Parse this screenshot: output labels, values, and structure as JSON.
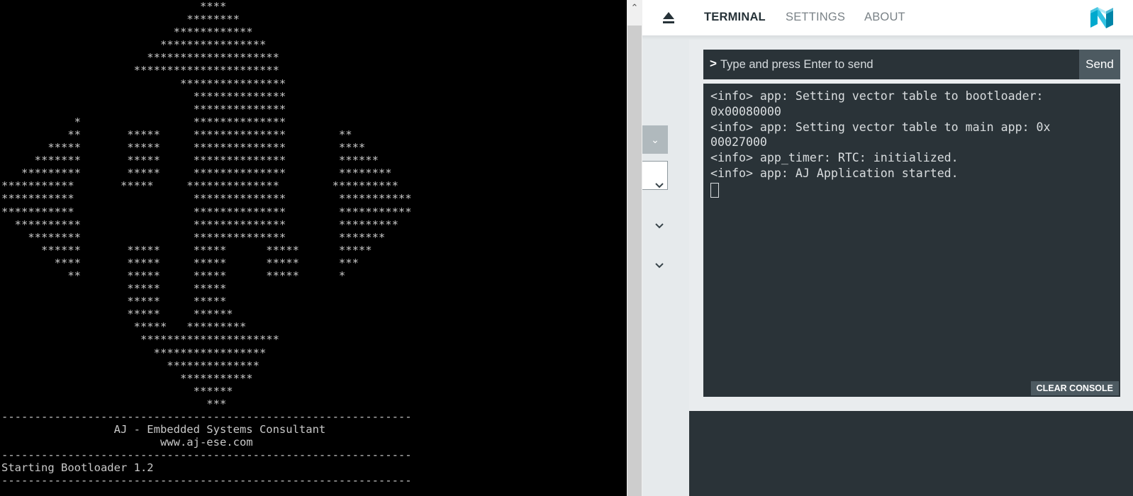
{
  "left_terminal": {
    "art": "                              ****\n                            ********\n                          ************\n                        ****************\n                      ********************\n                    **********************\n                           ****************\n                             **************\n                             **************\n           *                 **************\n          **       *****     **************        **\n       *****       *****     **************        ****\n     *******       *****     **************        ******\n   *********       *****     **************        ********\n***********       *****     **************        **********\n***********                  **************        ***********\n***********                  **************        ***********\n  **********                 **************        *********\n    ********                 **************        *******\n      ******       *****     *****      *****      *****\n        ****       *****     *****      *****      ***\n          **       *****     *****      *****      *\n                   *****     *****\n                   *****     *****\n                   *****     ******\n                    *****   *********\n                     *********************\n                       *****************\n                         **************\n                           ***********\n                             ******\n                               ***\n--------------------------------------------------------------\n                 AJ - Embedded Systems Consultant\n                        www.aj-ese.com\n--------------------------------------------------------------\nStarting Bootloader 1.2\n--------------------------------------------------------------"
  },
  "scrollbar": {
    "up_arrow": "⌃"
  },
  "header": {
    "tabs": [
      {
        "label": "TERMINAL",
        "active": true
      },
      {
        "label": "SETTINGS",
        "active": false
      },
      {
        "label": "ABOUT",
        "active": false
      }
    ],
    "eject_icon": "eject-icon",
    "logo": "nordic-logo"
  },
  "terminal": {
    "prompt": ">",
    "input_placeholder": "Type and press Enter to send",
    "input_value": "",
    "send_label": "Send",
    "console_lines": "<info> app: Setting vector table to bootloader:\n0x00080000\n<info> app: Setting vector table to main app: 0x\n00027000\n<info> app_timer: RTC: initialized.\n<info> app: AJ Application started.",
    "clear_label": "CLEAR CONSOLE"
  },
  "sidebar": {
    "dropdown_icon": "chevron-down-icon",
    "sections_collapsed": 3
  },
  "colors": {
    "dark_panel": "#2a3338",
    "light_panel": "#e9ecee",
    "accent_button": "#4d5a61",
    "logo_blue": "#00a9ce"
  }
}
